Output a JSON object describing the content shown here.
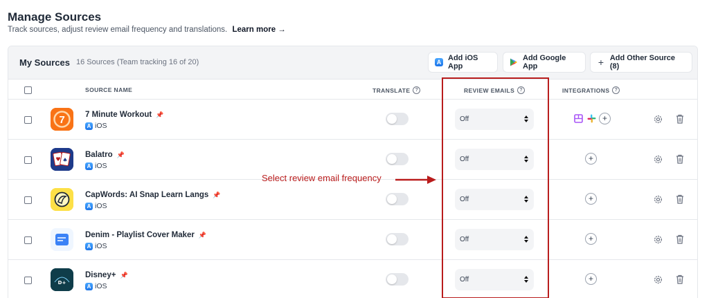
{
  "page": {
    "title": "Manage Sources",
    "subtitle": "Track sources, adjust review email frequency and translations.",
    "learn_more": "Learn more →"
  },
  "card": {
    "title": "My Sources",
    "count": "16 Sources (Team tracking 16 of 20)",
    "buttons": {
      "add_ios": "Add iOS App",
      "add_google": "Add Google App",
      "add_other": "Add Other Source (8)"
    }
  },
  "columns": {
    "source_name": "SOURCE NAME",
    "translate": "TRANSLATE",
    "review_emails": "REVIEW EMAILS",
    "integrations": "INTEGRATIONS"
  },
  "rows": [
    {
      "name": "7 Minute Workout",
      "platform": "iOS",
      "pinned": true,
      "translate": false,
      "review_emails": "Off",
      "integrations": [
        "notion-icon",
        "slack-icon"
      ]
    },
    {
      "name": "Balatro",
      "platform": "iOS",
      "pinned": false,
      "translate": false,
      "review_emails": "Off",
      "integrations": []
    },
    {
      "name": "CapWords: AI Snap Learn Langs",
      "platform": "iOS",
      "pinned": false,
      "translate": false,
      "review_emails": "Off",
      "integrations": []
    },
    {
      "name": "Denim - Playlist Cover Maker",
      "platform": "iOS",
      "pinned": false,
      "translate": false,
      "review_emails": "Off",
      "integrations": []
    },
    {
      "name": "Disney+",
      "platform": "iOS",
      "pinned": false,
      "translate": false,
      "review_emails": "Off",
      "integrations": []
    }
  ],
  "annotation": {
    "text": "Select review email frequency",
    "color": "#b91c1c"
  },
  "colors": {
    "accent_red": "#b91c1c",
    "header_bg": "#f3f4f6"
  }
}
